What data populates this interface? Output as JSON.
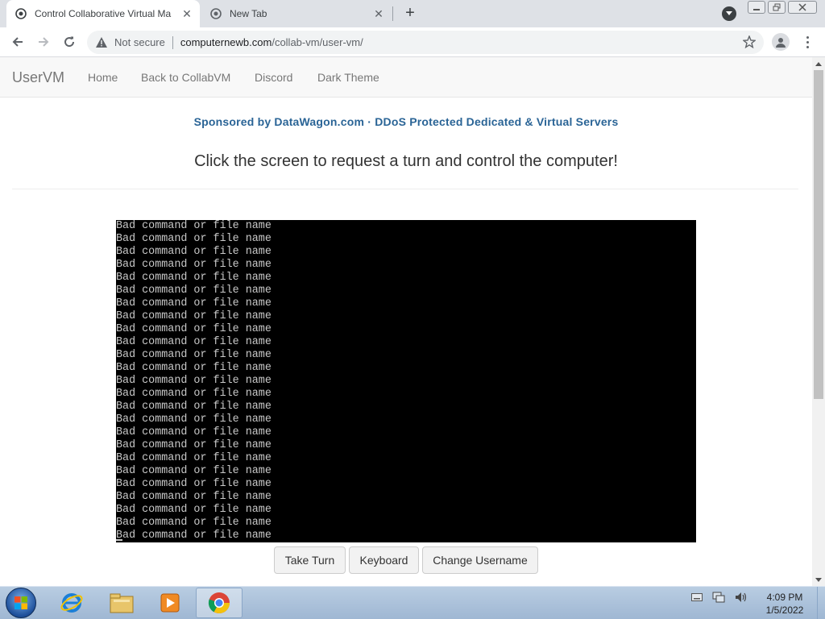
{
  "browser": {
    "tabs": [
      {
        "title": "Control Collaborative Virtual Ma",
        "active": true
      },
      {
        "title": "New Tab",
        "active": false
      }
    ],
    "new_tab_symbol": "+",
    "close_symbol": "✕",
    "security_label": "Not secure",
    "url_host": "computernewb.com",
    "url_path": "/collab-vm/user-vm/"
  },
  "navbar": {
    "brand": "UserVM",
    "links": [
      "Home",
      "Back to CollabVM",
      "Discord",
      "Dark Theme"
    ]
  },
  "page": {
    "sponsor": "Sponsored by DataWagon.com · DDoS Protected Dedicated & Virtual Servers",
    "headline": "Click the screen to request a turn and control the computer!"
  },
  "vm": {
    "lines": [
      "Bad command or file name",
      "Bad command or file name",
      "Bad command or file name",
      "Bad command or file name",
      "Bad command or file name",
      "Bad command or file name",
      "Bad command or file name",
      "Bad command or file name",
      "Bad command or file name",
      "Bad command or file name",
      "Bad command or file name",
      "Bad command or file name",
      "Bad command or file name",
      "Bad command or file name",
      "Bad command or file name",
      "Bad command or file name",
      "Bad command or file name",
      "Bad command or file name",
      "Bad command or file name",
      "Bad command or file name",
      "Bad command or file name",
      "Bad command or file name",
      "Bad command or file name",
      "Bad command or file name",
      "Bad command or file name"
    ],
    "buttons": [
      "Take Turn",
      "Keyboard",
      "Change Username"
    ]
  },
  "taskbar": {
    "time": "4:09 PM",
    "date": "1/5/2022",
    "pinned": [
      "internet-explorer-icon",
      "file-explorer-icon",
      "media-player-icon",
      "chrome-icon"
    ]
  },
  "colors": {
    "sponsor": "#2a6496",
    "terminal_bg": "#000000",
    "terminal_text": "#c8c8c8"
  }
}
